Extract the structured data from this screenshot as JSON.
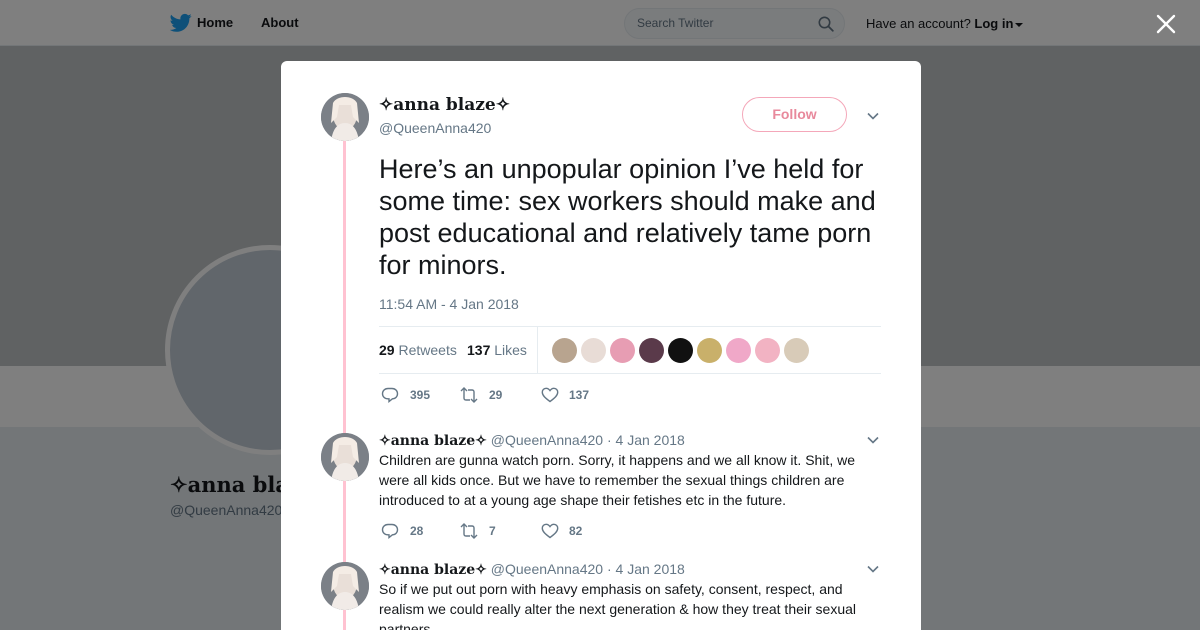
{
  "nav": {
    "home_label": "Home",
    "about_label": "About",
    "search_placeholder": "Search Twitter",
    "account_prompt": "Have an account?",
    "login_label": "Log in"
  },
  "profile": {
    "name": "✧anna bla",
    "handle": "@QueenAnna420"
  },
  "tweet": {
    "name": "✧anna blaze✧",
    "handle": "@QueenAnna420",
    "follow_label": "Follow",
    "text": "Here’s an unpopular opinion I’ve held for some time: sex workers should make and post educational and relatively tame porn for minors.",
    "timestamp": "11:54 AM - 4 Jan 2018",
    "retweets_count": "29",
    "retweets_label": "Retweets",
    "likes_count": "137",
    "likes_label": "Likes",
    "actions": {
      "replies": "395",
      "retweets": "29",
      "likes": "137"
    }
  },
  "replies": [
    {
      "name": "✧anna blaze✧",
      "handle": "@QueenAnna420",
      "date": "· 4 Jan 2018",
      "text": "Children are gunna watch porn. Sorry, it happens and we all know it. Shit, we were all kids once. But we have to remember the sexual things children are introduced to at a young age shape their fetishes etc in the future.",
      "actions": {
        "replies": "28",
        "retweets": "7",
        "likes": "82"
      }
    },
    {
      "name": "✧anna blaze✧",
      "handle": "@QueenAnna420",
      "date": "· 4 Jan 2018",
      "text": "So if we put out porn with heavy emphasis on safety, consent, respect, and realism we could really alter the next generation & how they treat their sexual partners.",
      "actions": {
        "replies": "",
        "retweets": "",
        "likes": ""
      }
    }
  ],
  "colors": {
    "accent_pink": "#e8899c",
    "thread_line": "#ffc2d1",
    "twitter_blue": "#1da1f2"
  }
}
